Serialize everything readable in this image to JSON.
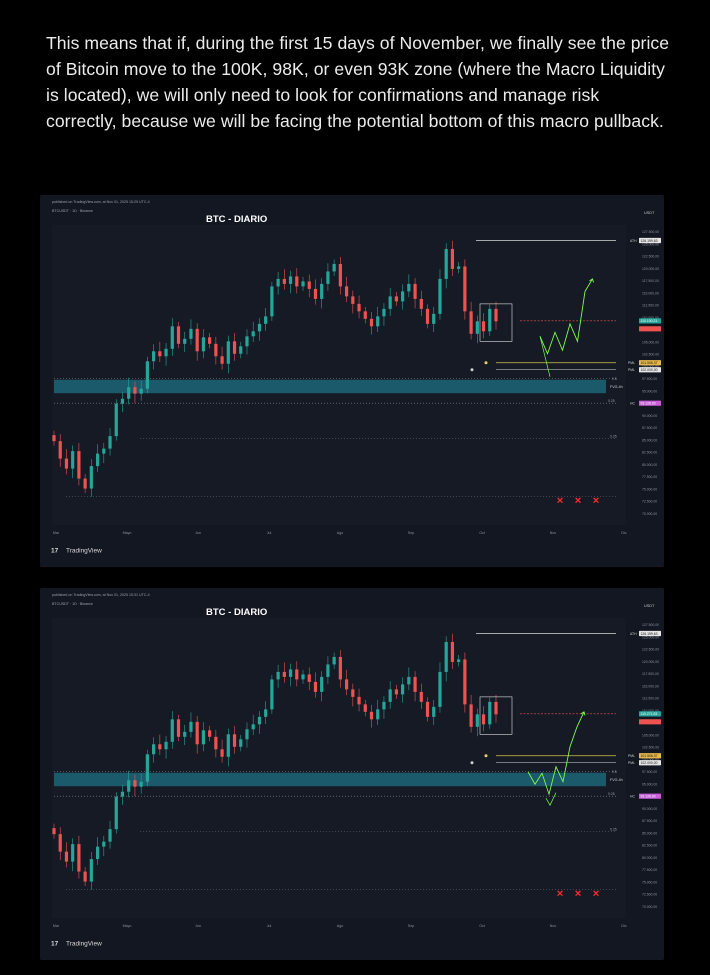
{
  "post": {
    "text": "This means that if, during the first 15 days of November, we finally see the price of Bitcoin move to the 100K, 98K, or even 93K zone (where the Macro Liquidity is located), we will only need to look for confirmations and manage risk correctly, because we will be facing the potential bottom of this macro pullback."
  },
  "colors": {
    "up": "#26a69a",
    "down": "#ef5350",
    "projection": "#7cfc4a",
    "liquidity_band": "#1b5e6e",
    "yellow_line": "#d8c44a",
    "purple_tag": "#c65fd8"
  },
  "chart_data": [
    {
      "type": "candlestick",
      "title": "BTC - DIARIO",
      "header_line": "published on TradingView.com, at Nov 01, 2025 15:29 UTC-4",
      "symbol_line": "BTCUSDT · 1D · Binance",
      "watermark": "TradingView",
      "currency": "USDT",
      "x_labels": [
        "Mar",
        "Mayo",
        "Jun",
        "Jul",
        "Ago",
        "Sep",
        "Oct",
        "Nov",
        "Dic"
      ],
      "y_ticks": [
        "127.500,00",
        "125.000,00",
        "122.500,00",
        "120.000,00",
        "117.500,00",
        "115.000,00",
        "112.500,00",
        "110.000,00",
        "107.500,00",
        "105.000,00",
        "102.500,00",
        "100.000,00",
        "97.500,00",
        "95.000,00",
        "92.500,00",
        "90.000,00",
        "87.500,00",
        "85.000,00",
        "82.500,00",
        "80.000,00",
        "77.500,00",
        "75.000,00",
        "72.500,00",
        "70.000,00"
      ],
      "ylim": [
        70000,
        128500
      ],
      "close_series": [
        86000,
        82500,
        80500,
        84000,
        78500,
        76500,
        81000,
        83500,
        84500,
        87000,
        93500,
        94500,
        96800,
        95500,
        96500,
        102000,
        104000,
        103000,
        104500,
        109000,
        105500,
        106500,
        108500,
        104000,
        106800,
        105500,
        103000,
        101500,
        106000,
        103500,
        105000,
        107000,
        108000,
        109500,
        111000,
        117000,
        118500,
        117500,
        119000,
        117000,
        118000,
        116500,
        114500,
        117500,
        120000,
        121500,
        117000,
        115000,
        113500,
        112000,
        110500,
        109000,
        111000,
        112500,
        115000,
        114000,
        116000,
        117500,
        114500,
        112500,
        109500,
        111500,
        118500,
        124500,
        120500,
        121000,
        112000,
        107500,
        110000,
        108000,
        112500,
        110000
      ],
      "levels": [
        {
          "label": "ATH",
          "value": "126.199,63",
          "price": 126200
        },
        {
          "label": "",
          "value": "110.100,21",
          "price": 110100
        },
        {
          "label": "PML",
          "value": "101.506,37",
          "price": 101700
        },
        {
          "label": "PML",
          "value": "102.000,00",
          "price": 100300
        },
        {
          "label": "0.5",
          "value": "",
          "price": 98500
        },
        {
          "label": "FVG-4h",
          "value": "",
          "price": 96900
        },
        {
          "label": "0.25",
          "value": "",
          "price": 93600
        },
        {
          "label": "0.25",
          "value": "",
          "price": 86500
        },
        {
          "label": "",
          "value": "",
          "price": 74900
        }
      ],
      "price_tags": {
        "current": "110.100,21",
        "pml1": "101.506,37",
        "pml2": "102.000,00",
        "bottom": "93.126,00"
      },
      "projection_points": [
        [
          107000,
          0
        ],
        [
          103500,
          1
        ],
        [
          107800,
          2
        ],
        [
          104200,
          3
        ],
        [
          109500,
          4
        ],
        [
          106000,
          5
        ],
        [
          116000,
          6
        ],
        [
          118500,
          7
        ]
      ],
      "marker_text": "✕"
    },
    {
      "type": "candlestick",
      "title": "BTC - DIARIO",
      "header_line": "published on TradingView.com, at Nov 01, 2025 15:31 UTC-4",
      "symbol_line": "BTCUSDT · 1D · Binance",
      "watermark": "TradingView",
      "currency": "USDT",
      "x_labels": [
        "Mar",
        "Mayo",
        "Jun",
        "Jul",
        "Ago",
        "Sep",
        "Oct",
        "Nov",
        "Dic"
      ],
      "y_ticks": [
        "127.500,00",
        "125.000,00",
        "122.500,00",
        "120.000,00",
        "117.500,00",
        "115.000,00",
        "112.500,00",
        "110.000,00",
        "107.500,00",
        "105.000,00",
        "102.500,00",
        "100.000,00",
        "97.500,00",
        "95.000,00",
        "92.500,00",
        "90.000,00",
        "87.500,00",
        "85.000,00",
        "82.500,00",
        "80.000,00",
        "77.500,00",
        "75.000,00",
        "72.500,00",
        "70.000,00"
      ],
      "ylim": [
        70000,
        128500
      ],
      "close_series": [
        86000,
        82500,
        80500,
        84000,
        78500,
        76500,
        81000,
        83500,
        84500,
        87000,
        93500,
        94500,
        96800,
        95500,
        96500,
        102000,
        104000,
        103000,
        104500,
        109000,
        105500,
        106500,
        108500,
        104000,
        106800,
        105500,
        103000,
        101500,
        106000,
        103500,
        105000,
        107000,
        108000,
        109500,
        111000,
        117000,
        118500,
        117500,
        119000,
        117000,
        118000,
        116500,
        114500,
        117500,
        120000,
        121500,
        117000,
        115000,
        113500,
        112000,
        110500,
        109000,
        111000,
        112500,
        115000,
        114000,
        116000,
        117500,
        114500,
        112500,
        109500,
        111500,
        118500,
        124500,
        120500,
        121000,
        112000,
        107500,
        110000,
        108000,
        112500,
        110000
      ],
      "levels": [
        {
          "label": "ATH",
          "value": "126.199,63",
          "price": 126200
        },
        {
          "label": "",
          "value": "110.271,53",
          "price": 110100
        },
        {
          "label": "PML",
          "value": "101.506,37",
          "price": 101700
        },
        {
          "label": "PML",
          "value": "102.000,00",
          "price": 100300
        },
        {
          "label": "0.5",
          "value": "",
          "price": 98500
        },
        {
          "label": "FVG-4h",
          "value": "",
          "price": 96900
        },
        {
          "label": "0.25",
          "value": "",
          "price": 93600
        },
        {
          "label": "0.25",
          "value": "",
          "price": 86500
        },
        {
          "label": "",
          "value": "",
          "price": 74900
        }
      ],
      "price_tags": {
        "current": "110.271,53",
        "pml1": "101.506,37",
        "pml2": "102.000,00",
        "bottom": "93.126,00"
      },
      "projection_points": [
        [
          98500,
          0
        ],
        [
          96000,
          1
        ],
        [
          98200,
          2
        ],
        [
          94000,
          3
        ],
        [
          99500,
          4
        ],
        [
          96500,
          5
        ],
        [
          103500,
          6
        ],
        [
          107500,
          7
        ],
        [
          110500,
          8
        ]
      ],
      "marker_text": "✕"
    }
  ]
}
